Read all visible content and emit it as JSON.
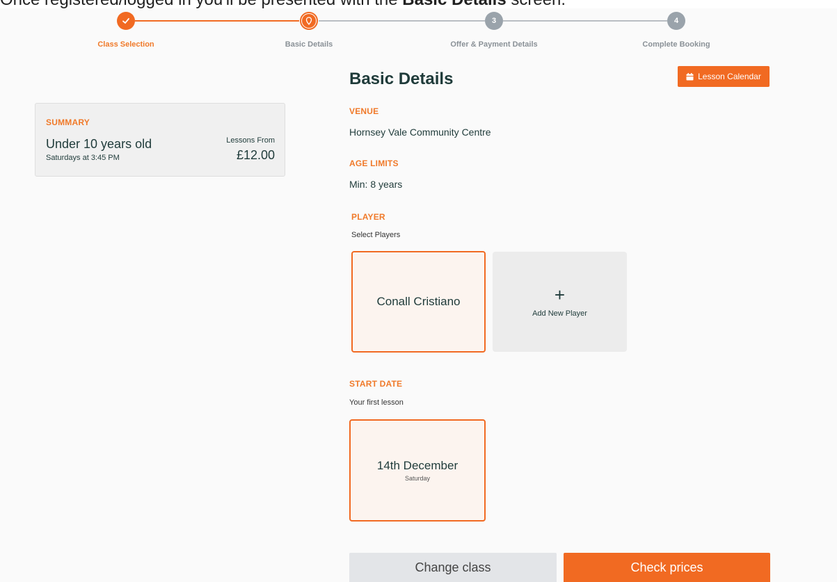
{
  "caption": {
    "prefix": "Once registered/logged in you'll be presented with the ",
    "bold": "Basic Details",
    "suffix": " screen."
  },
  "steps": [
    {
      "number": "",
      "label": "Class Selection",
      "state": "done",
      "icon": "check-icon"
    },
    {
      "number": "",
      "label": "Basic Details",
      "state": "active",
      "icon": "pin-icon"
    },
    {
      "number": "3",
      "label": "Offer & Payment Details",
      "state": "pending"
    },
    {
      "number": "4",
      "label": "Complete Booking",
      "state": "pending"
    }
  ],
  "summary": {
    "heading": "SUMMARY",
    "class_name": "Under 10 years old",
    "schedule": "Saturdays at 3:45 PM",
    "price_label": "Lessons From",
    "price": "£12.00"
  },
  "main": {
    "title": "Basic Details",
    "calendar_button": "Lesson Calendar",
    "venue_heading": "VENUE",
    "venue": "Hornsey Vale Community Centre",
    "age_heading": "AGE LIMITS",
    "age": "Min: 8 years",
    "player_heading": "PLAYER",
    "player_sub": "Select Players",
    "player_name": "Conall Cristiano",
    "add_player_symbol": "+",
    "add_player_label": "Add New Player",
    "start_heading": "START DATE",
    "start_sub": "Your first lesson",
    "start_date": "14th December",
    "start_day": "Saturday"
  },
  "buttons": {
    "change": "Change class",
    "check": "Check prices"
  },
  "colors": {
    "accent": "#f16a22",
    "pending": "#9aa3ab",
    "heading": "#1f3b3a"
  }
}
